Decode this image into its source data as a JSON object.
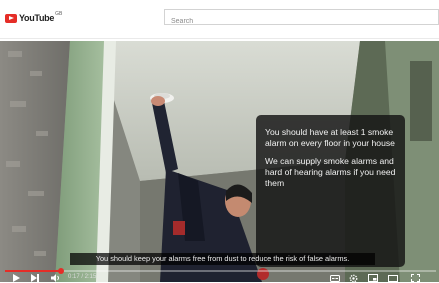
{
  "header": {
    "logo_text": "YouTube",
    "logo_superscript": "GB",
    "search_placeholder": "Search",
    "brand_color": "#e52d27"
  },
  "video": {
    "info_paragraph_1": "You should have at least 1 smoke alarm on every floor in your house",
    "info_paragraph_2": "We can supply smoke alarms and hard of hearing alarms if you need them",
    "caption": "You should keep your alarms free from dust to reduce the risk of false alarms.",
    "time_display": "0:17 / 2:15",
    "progress_fraction": 0.13
  },
  "controls": {
    "icons": [
      "play-icon",
      "next-icon",
      "volume-icon",
      "captions-icon",
      "settings-icon",
      "miniplayer-icon",
      "theater-icon",
      "fullscreen-icon"
    ]
  }
}
